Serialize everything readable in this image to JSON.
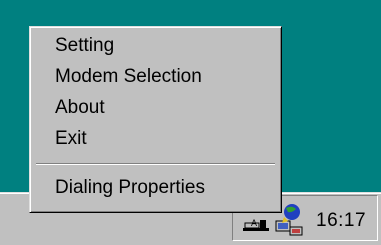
{
  "menu": {
    "items": [
      {
        "label": "Setting"
      },
      {
        "label": "Modem Selection"
      },
      {
        "label": "About"
      },
      {
        "label": "Exit"
      }
    ],
    "extra_item": {
      "label": "Dialing Properties"
    }
  },
  "tray": {
    "clock": "16:17",
    "icons": [
      "modem-icon",
      "network-icon"
    ]
  },
  "colors": {
    "desktop": "#008080",
    "menu_face": "#c0c0c0"
  }
}
